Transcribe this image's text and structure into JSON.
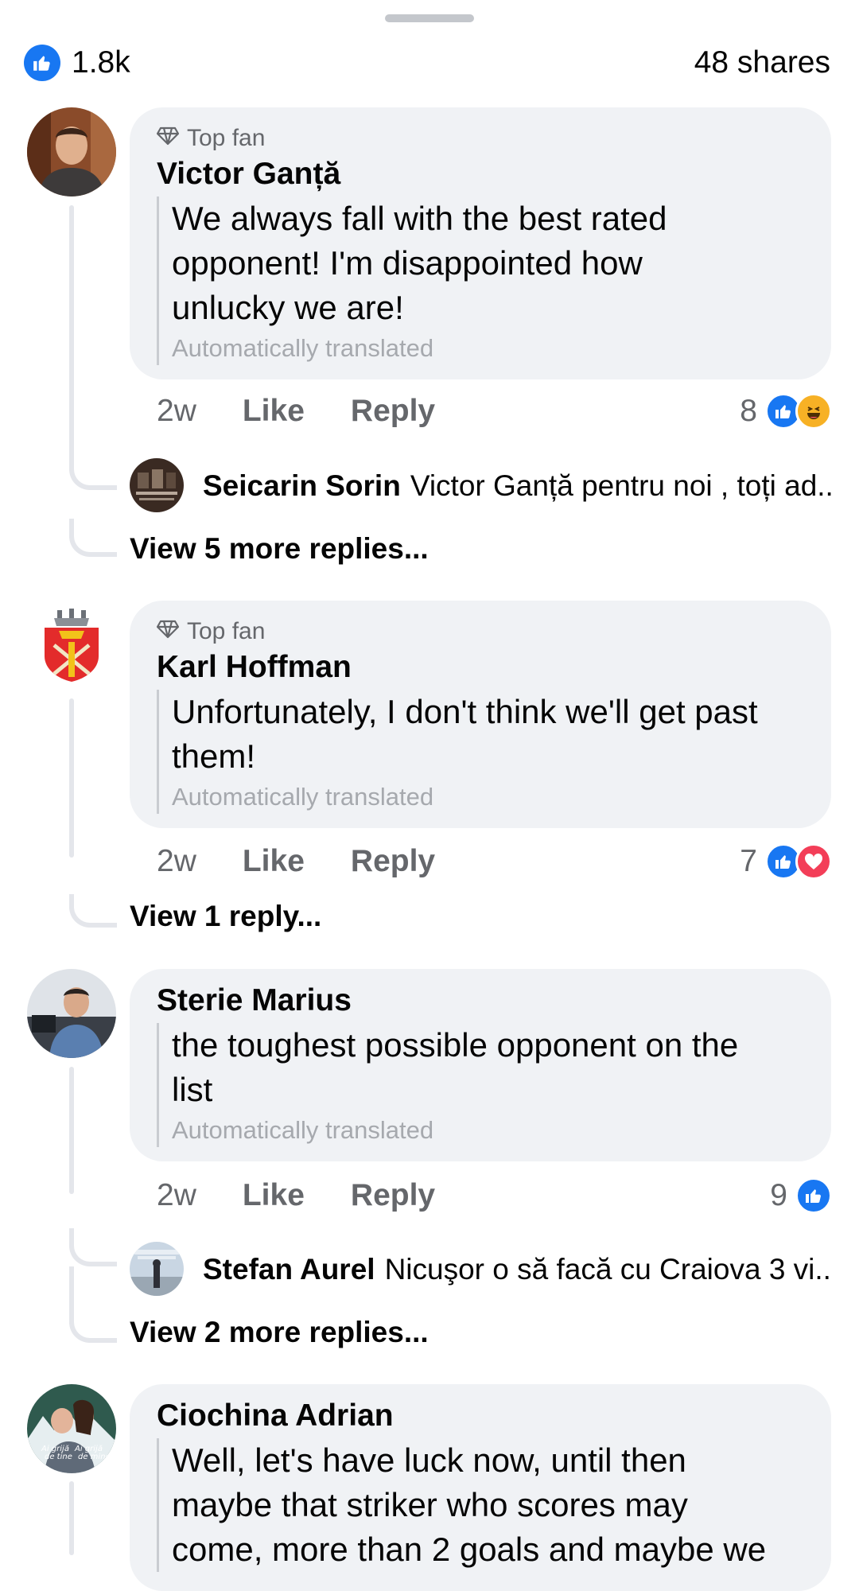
{
  "summary": {
    "likes_count": "1.8k",
    "shares": "48 shares"
  },
  "colors": {
    "like_blue": "#1877f2",
    "bubble_bg": "#f0f2f5",
    "secondary_text": "#65676b",
    "love_red": "#f33e58",
    "haha_yellow": "#f7b125"
  },
  "comments": [
    {
      "badge": "Top fan",
      "author": "Victor Ganță",
      "text_lines": [
        "We always fall with the best rated",
        "opponent! I'm disappointed how",
        "unlucky we are!"
      ],
      "translated": "Automatically translated",
      "time": "2w",
      "like": "Like",
      "reply": "Reply",
      "reaction_count": "8",
      "reactions": [
        "like-icon",
        "haha-icon"
      ],
      "reply_preview": {
        "name": "Seicarin Sorin",
        "text": "Victor Ganță pentru noi , toți ad..."
      },
      "view_more": "View 5 more replies..."
    },
    {
      "badge": "Top fan",
      "author": "Karl Hoffman",
      "text_lines": [
        "Unfortunately, I don't think we'll get past",
        "them!"
      ],
      "translated": "Automatically translated",
      "time": "2w",
      "like": "Like",
      "reply": "Reply",
      "reaction_count": "7",
      "reactions": [
        "like-icon",
        "love-icon"
      ],
      "view_more": "View 1 reply..."
    },
    {
      "author": "Sterie Marius",
      "text_lines": [
        "the toughest possible opponent on the",
        "list"
      ],
      "translated": "Automatically translated",
      "time": "2w",
      "like": "Like",
      "reply": "Reply",
      "reaction_count": "9",
      "reactions": [
        "like-icon"
      ],
      "reply_preview": {
        "name": "Stefan Aurel",
        "text": "Nicuşor o să facă cu Craiova 3 vi..."
      },
      "view_more": "View 2 more replies..."
    },
    {
      "author": "Ciochina Adrian",
      "avatar_text": [
        "Ai grijă",
        "de tine",
        "Ai grijă",
        "de mine"
      ],
      "text_lines": [
        "Well, let's have luck now, until then",
        "maybe that striker who scores may",
        "come, more than 2 goals and maybe we"
      ]
    }
  ]
}
